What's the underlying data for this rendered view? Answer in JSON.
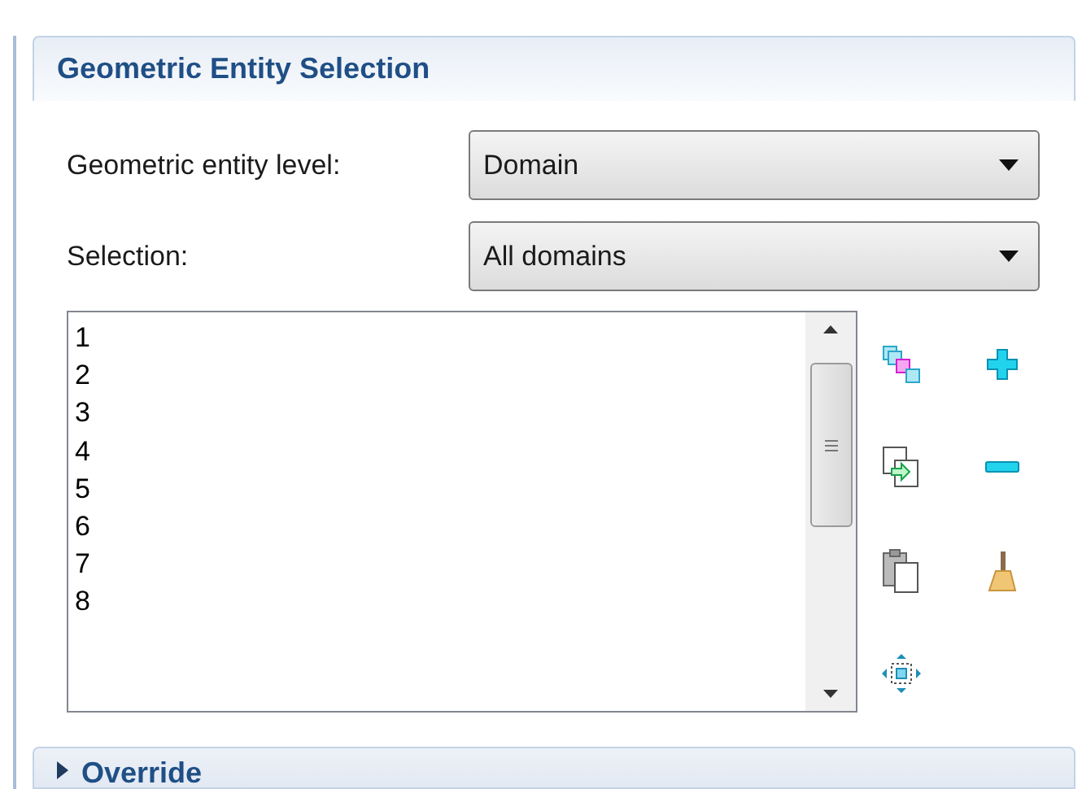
{
  "sections": [
    {
      "title": "Geometric Entity Selection",
      "expanded": true,
      "fields": [
        {
          "label": "Geometric entity level:",
          "value": "Domain"
        },
        {
          "label": "Selection:",
          "value": "All domains"
        }
      ],
      "list": {
        "items": [
          "1",
          "2",
          "3",
          "4",
          "5",
          "6",
          "7",
          "8"
        ]
      }
    },
    {
      "title": "Override",
      "expanded": false
    }
  ]
}
